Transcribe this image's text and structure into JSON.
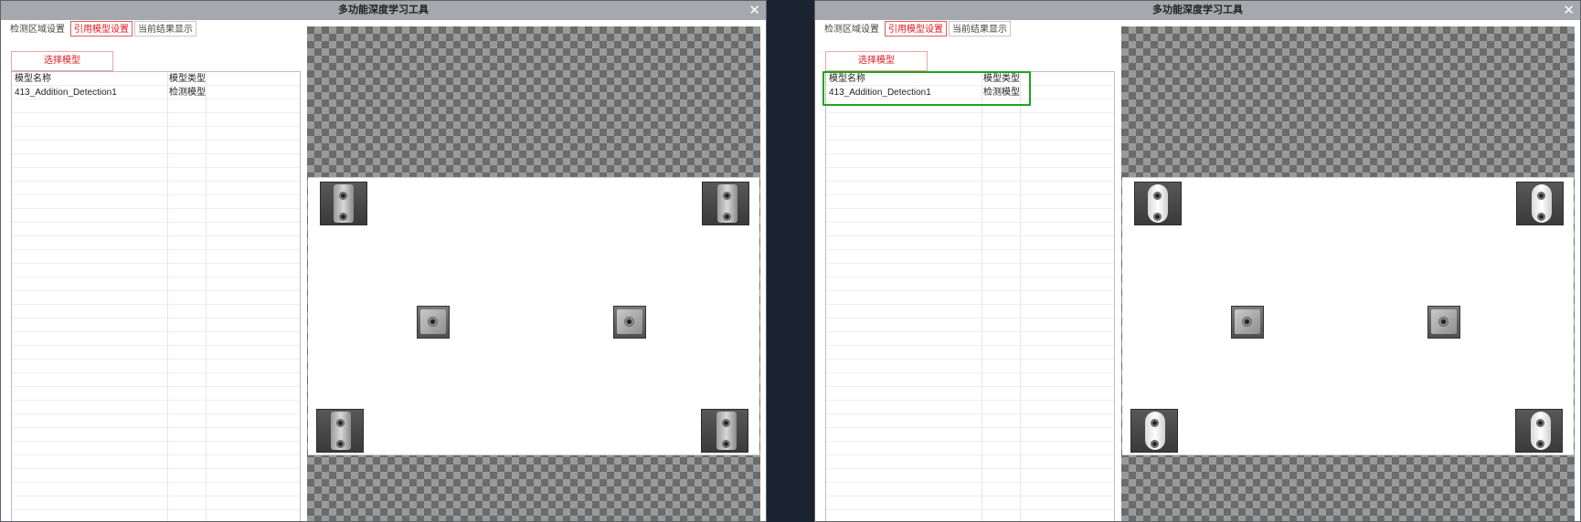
{
  "window": {
    "title": "多功能深度学习工具",
    "close_glyph": "✕"
  },
  "tabs": [
    {
      "label": "检测区域设置",
      "active": false
    },
    {
      "label": "引用模型设置",
      "active": true
    },
    {
      "label": "当前结果显示",
      "active": false
    }
  ],
  "select_model_label": "选择模型",
  "table": {
    "columns": [
      "模型名称",
      "模型类型"
    ],
    "rows": [
      [
        "413_Addition_Detection1",
        "检测模型"
      ]
    ]
  },
  "highlight_color": "#17a81b",
  "accent_color": "#e0181e"
}
